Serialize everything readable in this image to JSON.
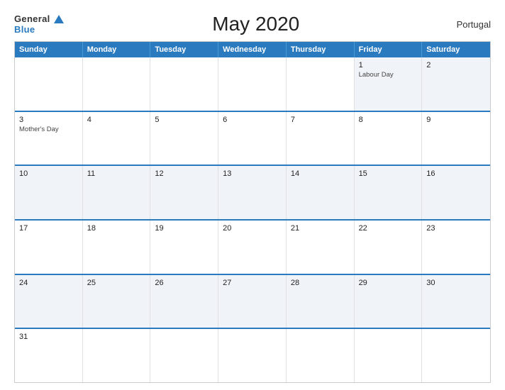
{
  "logo": {
    "general": "General",
    "blue": "Blue",
    "triangle": true
  },
  "header": {
    "title": "May 2020",
    "country": "Portugal"
  },
  "days_of_week": [
    "Sunday",
    "Monday",
    "Tuesday",
    "Wednesday",
    "Thursday",
    "Friday",
    "Saturday"
  ],
  "weeks": [
    [
      {
        "date": "",
        "events": [],
        "empty": true
      },
      {
        "date": "",
        "events": [],
        "empty": true
      },
      {
        "date": "",
        "events": [],
        "empty": true
      },
      {
        "date": "",
        "events": [],
        "empty": true
      },
      {
        "date": "",
        "events": [],
        "empty": true
      },
      {
        "date": "1",
        "events": [
          "Labour Day"
        ],
        "empty": false
      },
      {
        "date": "2",
        "events": [],
        "empty": false
      }
    ],
    [
      {
        "date": "3",
        "events": [
          "Mother's Day"
        ],
        "empty": false
      },
      {
        "date": "4",
        "events": [],
        "empty": false
      },
      {
        "date": "5",
        "events": [],
        "empty": false
      },
      {
        "date": "6",
        "events": [],
        "empty": false
      },
      {
        "date": "7",
        "events": [],
        "empty": false
      },
      {
        "date": "8",
        "events": [],
        "empty": false
      },
      {
        "date": "9",
        "events": [],
        "empty": false
      }
    ],
    [
      {
        "date": "10",
        "events": [],
        "empty": false
      },
      {
        "date": "11",
        "events": [],
        "empty": false
      },
      {
        "date": "12",
        "events": [],
        "empty": false
      },
      {
        "date": "13",
        "events": [],
        "empty": false
      },
      {
        "date": "14",
        "events": [],
        "empty": false
      },
      {
        "date": "15",
        "events": [],
        "empty": false
      },
      {
        "date": "16",
        "events": [],
        "empty": false
      }
    ],
    [
      {
        "date": "17",
        "events": [],
        "empty": false
      },
      {
        "date": "18",
        "events": [],
        "empty": false
      },
      {
        "date": "19",
        "events": [],
        "empty": false
      },
      {
        "date": "20",
        "events": [],
        "empty": false
      },
      {
        "date": "21",
        "events": [],
        "empty": false
      },
      {
        "date": "22",
        "events": [],
        "empty": false
      },
      {
        "date": "23",
        "events": [],
        "empty": false
      }
    ],
    [
      {
        "date": "24",
        "events": [],
        "empty": false
      },
      {
        "date": "25",
        "events": [],
        "empty": false
      },
      {
        "date": "26",
        "events": [],
        "empty": false
      },
      {
        "date": "27",
        "events": [],
        "empty": false
      },
      {
        "date": "28",
        "events": [],
        "empty": false
      },
      {
        "date": "29",
        "events": [],
        "empty": false
      },
      {
        "date": "30",
        "events": [],
        "empty": false
      }
    ],
    [
      {
        "date": "31",
        "events": [],
        "empty": false
      },
      {
        "date": "",
        "events": [],
        "empty": true
      },
      {
        "date": "",
        "events": [],
        "empty": true
      },
      {
        "date": "",
        "events": [],
        "empty": true
      },
      {
        "date": "",
        "events": [],
        "empty": true
      },
      {
        "date": "",
        "events": [],
        "empty": true
      },
      {
        "date": "",
        "events": [],
        "empty": true
      }
    ]
  ]
}
